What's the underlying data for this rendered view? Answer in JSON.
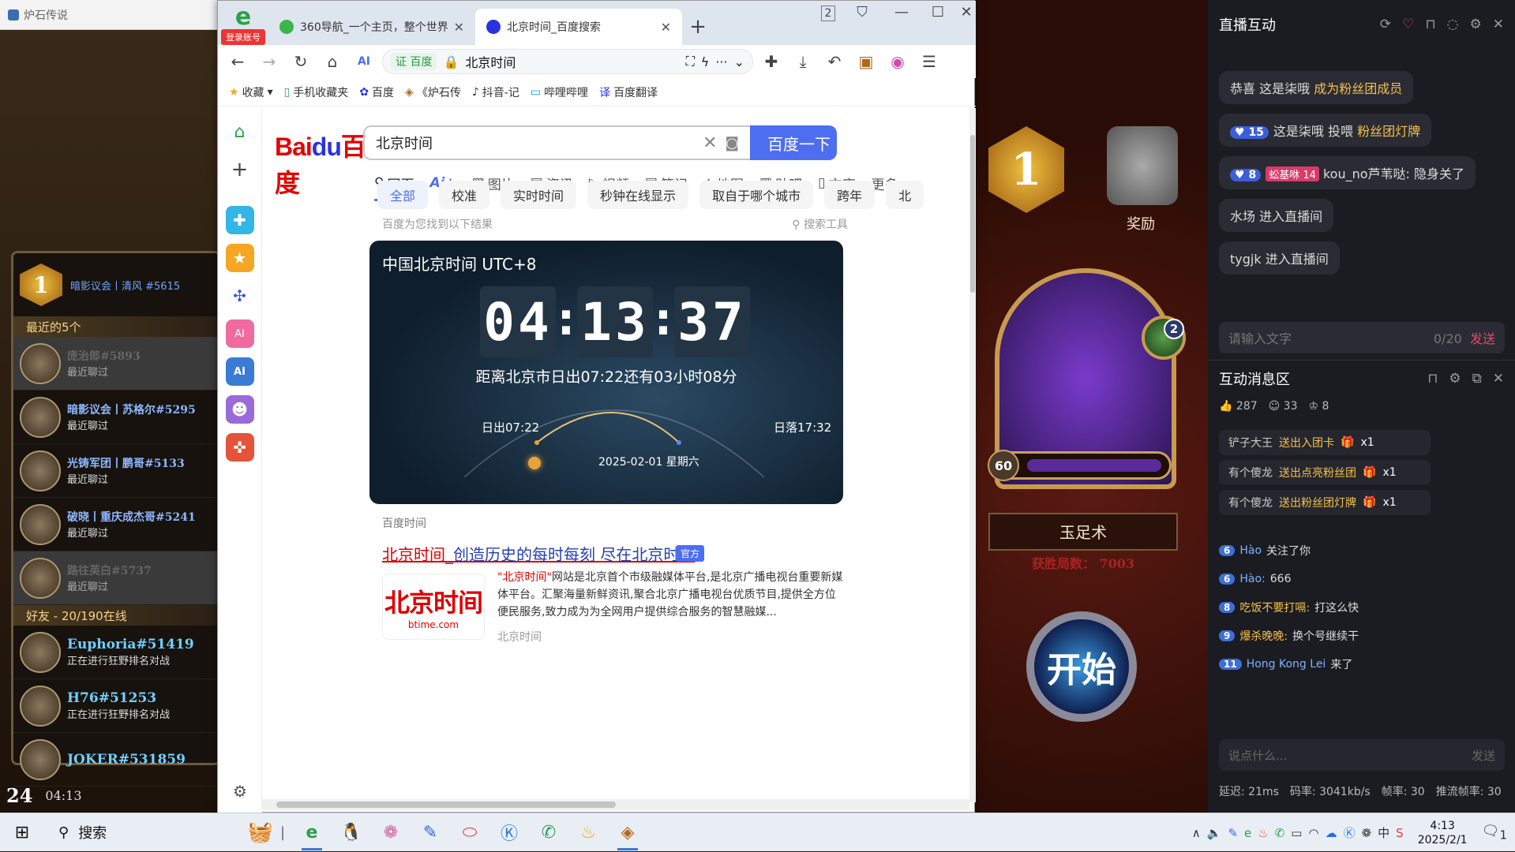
{
  "hs": {
    "title": "炉石传说",
    "header_name": "暗影议会丨清风 #5615",
    "rank_small": "1",
    "recent_label": "最近的5个",
    "recent": [
      {
        "name": "庞治郎#5893",
        "status": "最近聊过",
        "gray": true
      },
      {
        "name": "暗影议会丨苏格尔#5295",
        "status": "最近聊过",
        "gray": false
      },
      {
        "name": "光铸军团丨鹏哥#5133",
        "status": "最近聊过",
        "gray": false
      },
      {
        "name": "破晓丨重庆成杰哥#5241",
        "status": "最近聊过",
        "gray": false
      },
      {
        "name": "路往英白#5737",
        "status": "最近聊过",
        "gray": true
      }
    ],
    "friends_label": "好友 - 20/190在线",
    "friends": [
      {
        "name": "Euphoria#51419",
        "status": "正在进行狂野排名对战"
      },
      {
        "name": "H76#51253",
        "status": "正在进行狂野排名对战"
      },
      {
        "name": "JOKER#531859",
        "status": ""
      }
    ],
    "online_count": "24",
    "time": "04:13",
    "rank_big": "1",
    "reward_label": "奖励",
    "hero_level": "60",
    "hero_name": "玉足术",
    "wins": "获胜局数： 7003",
    "start": "开始",
    "badge_num": "2"
  },
  "browser": {
    "login": "登录账号",
    "tabs": [
      {
        "title": "360导航_一个主页，整个世界",
        "active": false
      },
      {
        "title": "北京时间_百度搜索",
        "active": true
      }
    ],
    "tab_count": "2",
    "address_site": "证 百度",
    "address_text": "北京时间",
    "bookmarks": [
      "收藏",
      "手机收藏夹",
      "百度",
      "《炉石传",
      "抖音-记",
      "哔哩哔哩",
      "百度翻译"
    ]
  },
  "baidu": {
    "query": "北京时间",
    "search_btn": "百度一下",
    "tabs": [
      "网页",
      "Ai+",
      "图片",
      "资讯",
      "视频",
      "笔记",
      "地图",
      "贴吧",
      "文库",
      "更多"
    ],
    "chips": [
      "全部",
      "校准",
      "实时时间",
      "秒钟在线显示",
      "取自于哪个城市",
      "跨年",
      "北"
    ],
    "found": "百度为您找到以下结果",
    "tools": "搜索工具",
    "card_title": "中国北京时间 UTC+8",
    "hh": "04",
    "mm": "13",
    "ss": "37",
    "sunrise_text": "距离北京市日出07:22还有03小时08分",
    "rise": "日出07:22",
    "set": "日落17:32",
    "date": "2025-02-01   星期六",
    "source": "百度时间",
    "res_title_red": "北京时间",
    "res_title_rest": "_创造历史的每时每刻 尽在北京时间",
    "official": "官方",
    "img_big": "北京时间",
    "img_small": "btime.com",
    "desc_hl": "\"北京时间\"",
    "desc": "网站是北京首个市级融媒体平台,是北京广播电视台重要新媒体平台。汇聚海量新鲜资讯,聚合北京广播电视台优质节目,提供全方位便民服务,致力成为为全网用户提供综合服务的智慧融媒...",
    "site": "北京时间"
  },
  "live": {
    "title": "直播互动",
    "msgs": [
      {
        "pre": "恭喜 这是柒哦 ",
        "hl": "成为粉丝团成员",
        "badge": "",
        "extra": ""
      },
      {
        "pre": "这是柒哦 投喂 ",
        "hl": "粉丝团灯牌",
        "badge": "15",
        "extra": ""
      },
      {
        "pre": "kou_no芦苇哒: 隐身关了",
        "hl": "",
        "badge": "8",
        "extra": "蚣基咻 14"
      },
      {
        "pre": "水场 进入直播间",
        "hl": "",
        "badge": "",
        "extra": ""
      },
      {
        "pre": "tygjk 进入直播间",
        "hl": "",
        "badge": "",
        "extra": ""
      }
    ],
    "input_ph": "请输入文字",
    "counter": "0/20",
    "send": "发送",
    "inter_title": "互动消息区",
    "likes": "287",
    "viewers": "33",
    "fans": "8",
    "gifts": [
      {
        "who": "铲子大王",
        "act": "送出入团卡",
        "n": "x1"
      },
      {
        "who": "有个傻龙",
        "act": "送出点亮粉丝团",
        "n": "x1"
      },
      {
        "who": "有个傻龙",
        "act": "送出粉丝团灯牌",
        "n": "x1"
      }
    ],
    "chat": [
      {
        "lv": "6",
        "name": "Hào",
        "text": "关注了你",
        "gold": false
      },
      {
        "lv": "6",
        "name": "Hào:",
        "text": "666",
        "gold": false
      },
      {
        "lv": "8",
        "name": "吃饭不要打嗝:",
        "text": "打这么快",
        "gold": true
      },
      {
        "lv": "9",
        "name": "爆杀晚晚:",
        "text": "换个号继续干",
        "gold": true
      },
      {
        "lv": "11",
        "name": "Hong Kong Lei",
        "text": "来了",
        "gold": false
      }
    ],
    "say_ph": "说点什么...",
    "say_send": "发送",
    "foot": [
      "延迟: 21ms",
      "码率: 3041kb/s",
      "帧率: 30",
      "推流帧率: 30"
    ]
  },
  "taskbar": {
    "search": "搜索",
    "time": "4:13",
    "date": "2025/2/1",
    "ime": "中",
    "notif": "1"
  }
}
